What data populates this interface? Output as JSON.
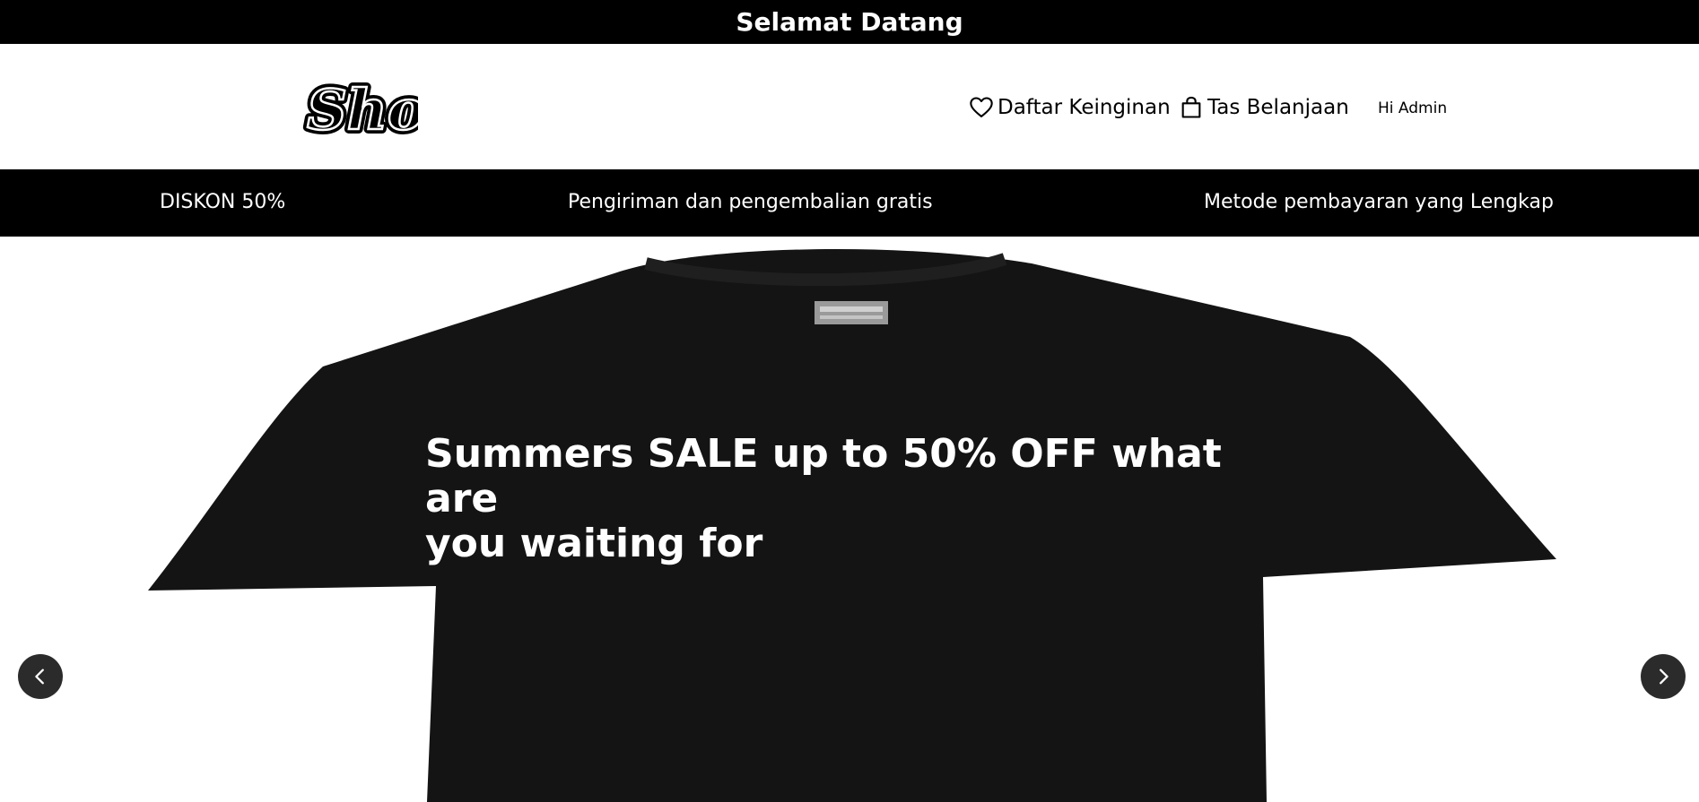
{
  "top_bar": {
    "welcome_text": "Selamat Datang"
  },
  "header": {
    "logo_text": "Shop",
    "wishlist_label": "Daftar Keinginan",
    "bag_label": "Tas Belanjaan",
    "user_greeting": "Hi Admin"
  },
  "promo_bar": {
    "items": [
      {
        "label": "DISKON 50%"
      },
      {
        "label": "Pengiriman dan pengembalian gratis"
      },
      {
        "label": "Metode pembayaran yang Lengkap"
      }
    ]
  },
  "hero": {
    "title_line1": "Summers SALE up to 50% OFF what are",
    "title_line2": "you waiting for",
    "prev_icon": "chevron-left-icon",
    "next_icon": "chevron-right-icon"
  },
  "colors": {
    "bar_background": "#000000",
    "bar_text": "#ffffff",
    "shirt": "#141414",
    "arrow_background": "#2b2b2b"
  }
}
